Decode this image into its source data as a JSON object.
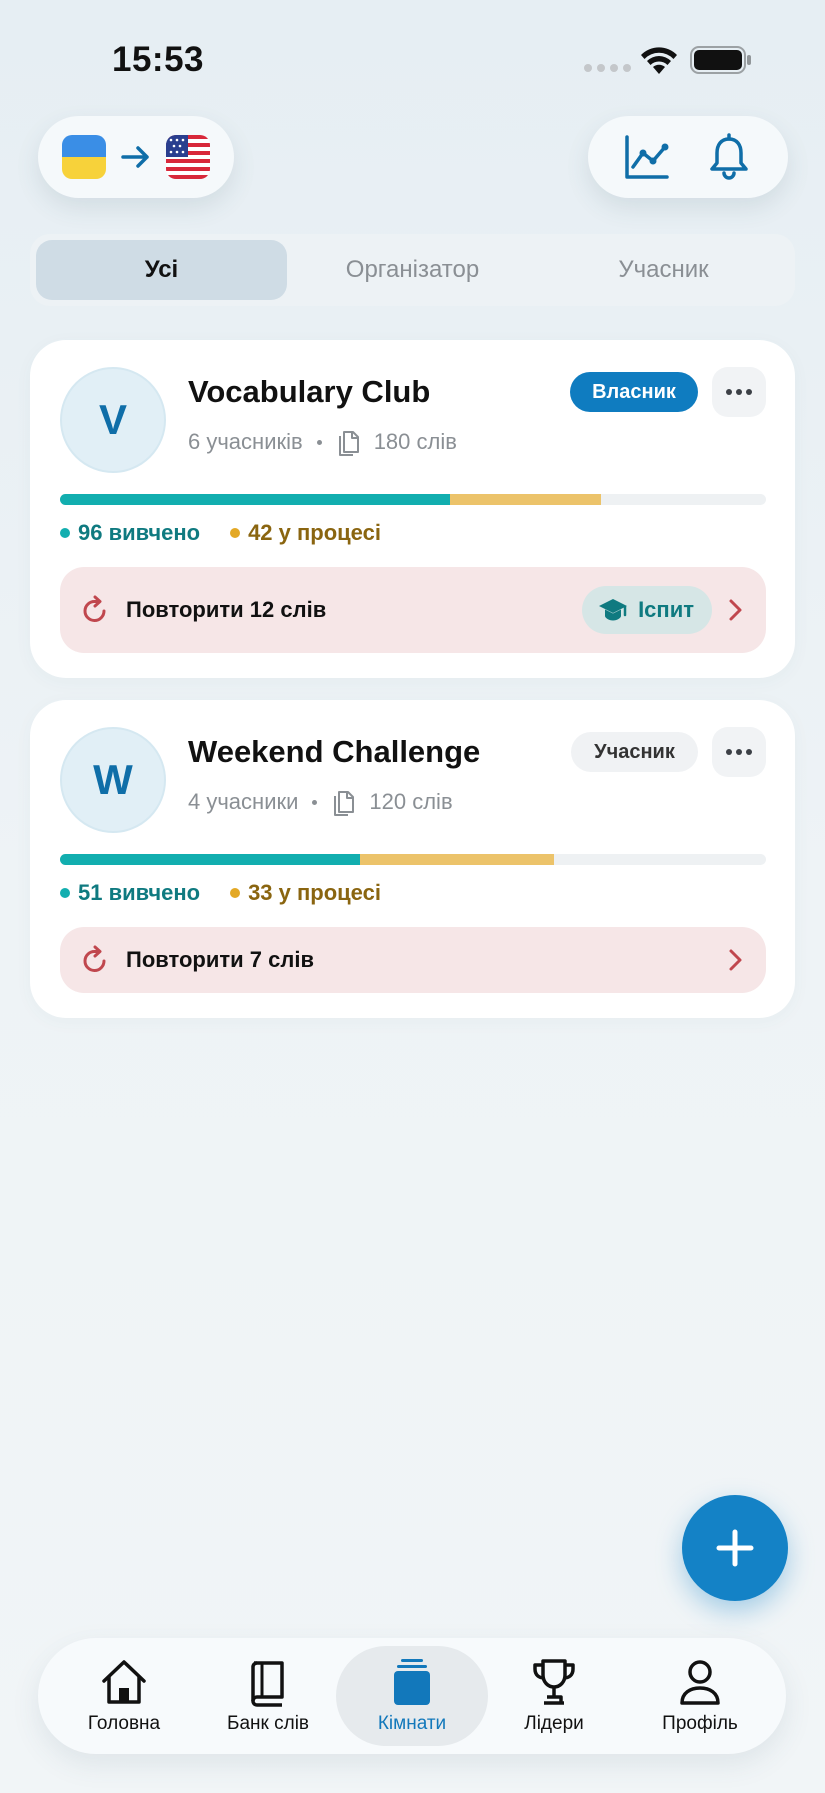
{
  "status": {
    "time": "15:53"
  },
  "header": {
    "from_flag": "ukraine-flag",
    "to_flag": "usa-flag",
    "icons": [
      "stats-chart-icon",
      "bell-icon"
    ]
  },
  "filters": [
    {
      "label": "Усі",
      "active": true
    },
    {
      "label": "Організатор",
      "active": false
    },
    {
      "label": "Учасник",
      "active": false
    }
  ],
  "rooms": [
    {
      "initial": "V",
      "name": "Vocabulary Club",
      "members": "6 учасників",
      "words": "180 слів",
      "role": "Власник",
      "learned_fraction": 0.553,
      "in_progress_fraction": 0.213,
      "learned_label": "96 вивчено",
      "in_progress_label": "42 у процесі",
      "review_label": "Повторити 12 слів",
      "exam_label": "Іспит"
    },
    {
      "initial": "W",
      "name": "Weekend Challenge",
      "members": "4 учасники",
      "words": "120 слів",
      "role": "Учасник",
      "learned_fraction": 0.425,
      "in_progress_fraction": 0.275,
      "learned_label": "51 вивчено",
      "in_progress_label": "33 у процесі",
      "review_label": "Повторити 7 слів"
    }
  ],
  "colors": {
    "accent": "#1482c6",
    "learned": "#12aeaf",
    "in_progress": "#ecc36a",
    "review_bg": "#f6e6e7"
  },
  "tabs": [
    {
      "label": "Головна",
      "icon": "home-icon"
    },
    {
      "label": "Банк слів",
      "icon": "book-icon"
    },
    {
      "label": "Кімнати",
      "icon": "rooms-icon",
      "active": true
    },
    {
      "label": "Лідери",
      "icon": "trophy-icon"
    },
    {
      "label": "Профіль",
      "icon": "profile-icon"
    }
  ]
}
